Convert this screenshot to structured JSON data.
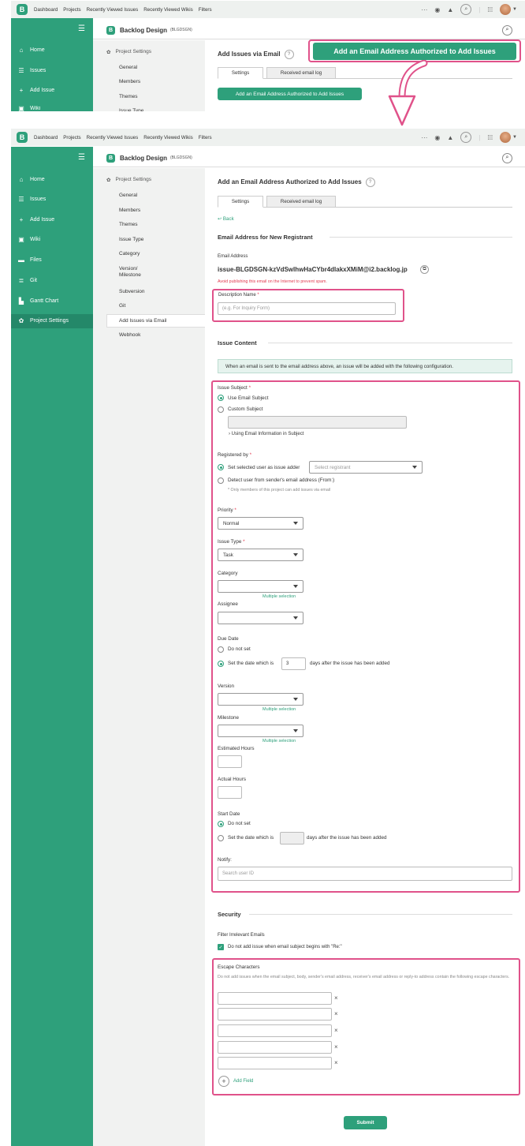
{
  "topnav": {
    "logo": "B",
    "items": [
      "Dashboard",
      "Projects",
      "Recently Viewed Issues",
      "Recently Viewed Wikis",
      "Filters"
    ],
    "more": "···"
  },
  "sidebar": {
    "menu_icon": "☰",
    "items": [
      {
        "label": "Home",
        "icon": "home-icon"
      },
      {
        "label": "Issues",
        "icon": "list-icon"
      },
      {
        "label": "Add Issue",
        "icon": "plus-icon"
      },
      {
        "label": "Wiki",
        "icon": "wiki-icon"
      },
      {
        "label": "Files",
        "icon": "files-icon"
      },
      {
        "label": "Git",
        "icon": "git-icon"
      },
      {
        "label": "Gantt Chart",
        "icon": "gantt-icon"
      },
      {
        "label": "Project Settings",
        "icon": "gear-icon"
      }
    ],
    "top_items": [
      "Home",
      "Issues",
      "Add Issue",
      "Wiki"
    ]
  },
  "project": {
    "logo": "B",
    "name": "Backlog Design",
    "key": "(BLGDSGN)"
  },
  "settings_nav": {
    "header": "Project Settings",
    "items": [
      "General",
      "Members",
      "Themes",
      "Issue Type",
      "Category",
      "Version/ Milestone",
      "Subversion",
      "Git",
      "Add Issues via Email",
      "Webhook"
    ],
    "top_items": [
      "General",
      "Members",
      "Themes",
      "Issue Type"
    ]
  },
  "top_panel": {
    "title": "Add Issues via Email",
    "tabs": [
      "Settings",
      "Received email log"
    ],
    "button": "Add an Email Address Authorized to Add Issues",
    "callout": "Add an Email Address Authorized to Add Issues"
  },
  "main": {
    "title": "Add an Email Address Authorized to Add Issues",
    "tabs": [
      "Settings",
      "Received email log"
    ],
    "back": "Back",
    "section_registrant": "Email Address for New Registrant",
    "email_label": "Email Address",
    "email_value": "issue-BLGDSGN-kzVdSwlhwHaCYbr4dlakxXMiM@i2.backlog.jp",
    "email_warning": "Avoid publishing this email on the Internet to prevent spam.",
    "description_label": "Description Name",
    "description_placeholder": "(e.g. For Inquiry Form)",
    "section_issue": "Issue Content",
    "info": "When an email is sent to the email address above, an issue will be added with the following configuration.",
    "issue_subject": {
      "label": "Issue Subject",
      "opt1": "Use Email Subject",
      "opt2": "Custom Subject",
      "expand": "Using Email Information in Subject"
    },
    "registered_by": {
      "label": "Registered by",
      "opt1": "Set selected user as issue adder",
      "select_placeholder": "Select registrant",
      "opt2": "Detect user from sender's email address (From:)",
      "note": "* Only members of this project can add issues via email"
    },
    "priority": {
      "label": "Priority",
      "value": "Normal"
    },
    "issue_type": {
      "label": "Issue Type",
      "value": "Task"
    },
    "category": {
      "label": "Category",
      "multi": "Multiple selection"
    },
    "assignee": {
      "label": "Assignee"
    },
    "due_date": {
      "label": "Due Date",
      "opt1": "Do not set",
      "opt2_pre": "Set the date which is",
      "days": "3",
      "opt2_post": "days after the issue has been added"
    },
    "version": {
      "label": "Version",
      "multi": "Multiple selection"
    },
    "milestone": {
      "label": "Milestone",
      "multi": "Multiple selection"
    },
    "estimated_hours": "Estimated Hours",
    "actual_hours": "Actual Hours",
    "start_date": {
      "label": "Start Date",
      "opt1": "Do not set",
      "opt2_pre": "Set the date which is",
      "opt2_post": "days after the issue has been added"
    },
    "notify": {
      "label": "Notify:",
      "placeholder": "Search user ID"
    },
    "section_security": "Security",
    "filter_label": "Filter Irrelevant Emails",
    "filter_check": "Do not add issue when email subject begins with \"Re:\"",
    "escape": {
      "label": "Escape Characters",
      "desc": "Do not add issues when the email subject, body, sender's email address, receiver's email address or reply-to address contain the following escape characters.",
      "remove": "×",
      "add": "Add Field"
    },
    "submit": "Submit"
  },
  "colors": {
    "brand": "#2ea07b",
    "highlight": "#e0528a",
    "required": "#e2394f"
  }
}
